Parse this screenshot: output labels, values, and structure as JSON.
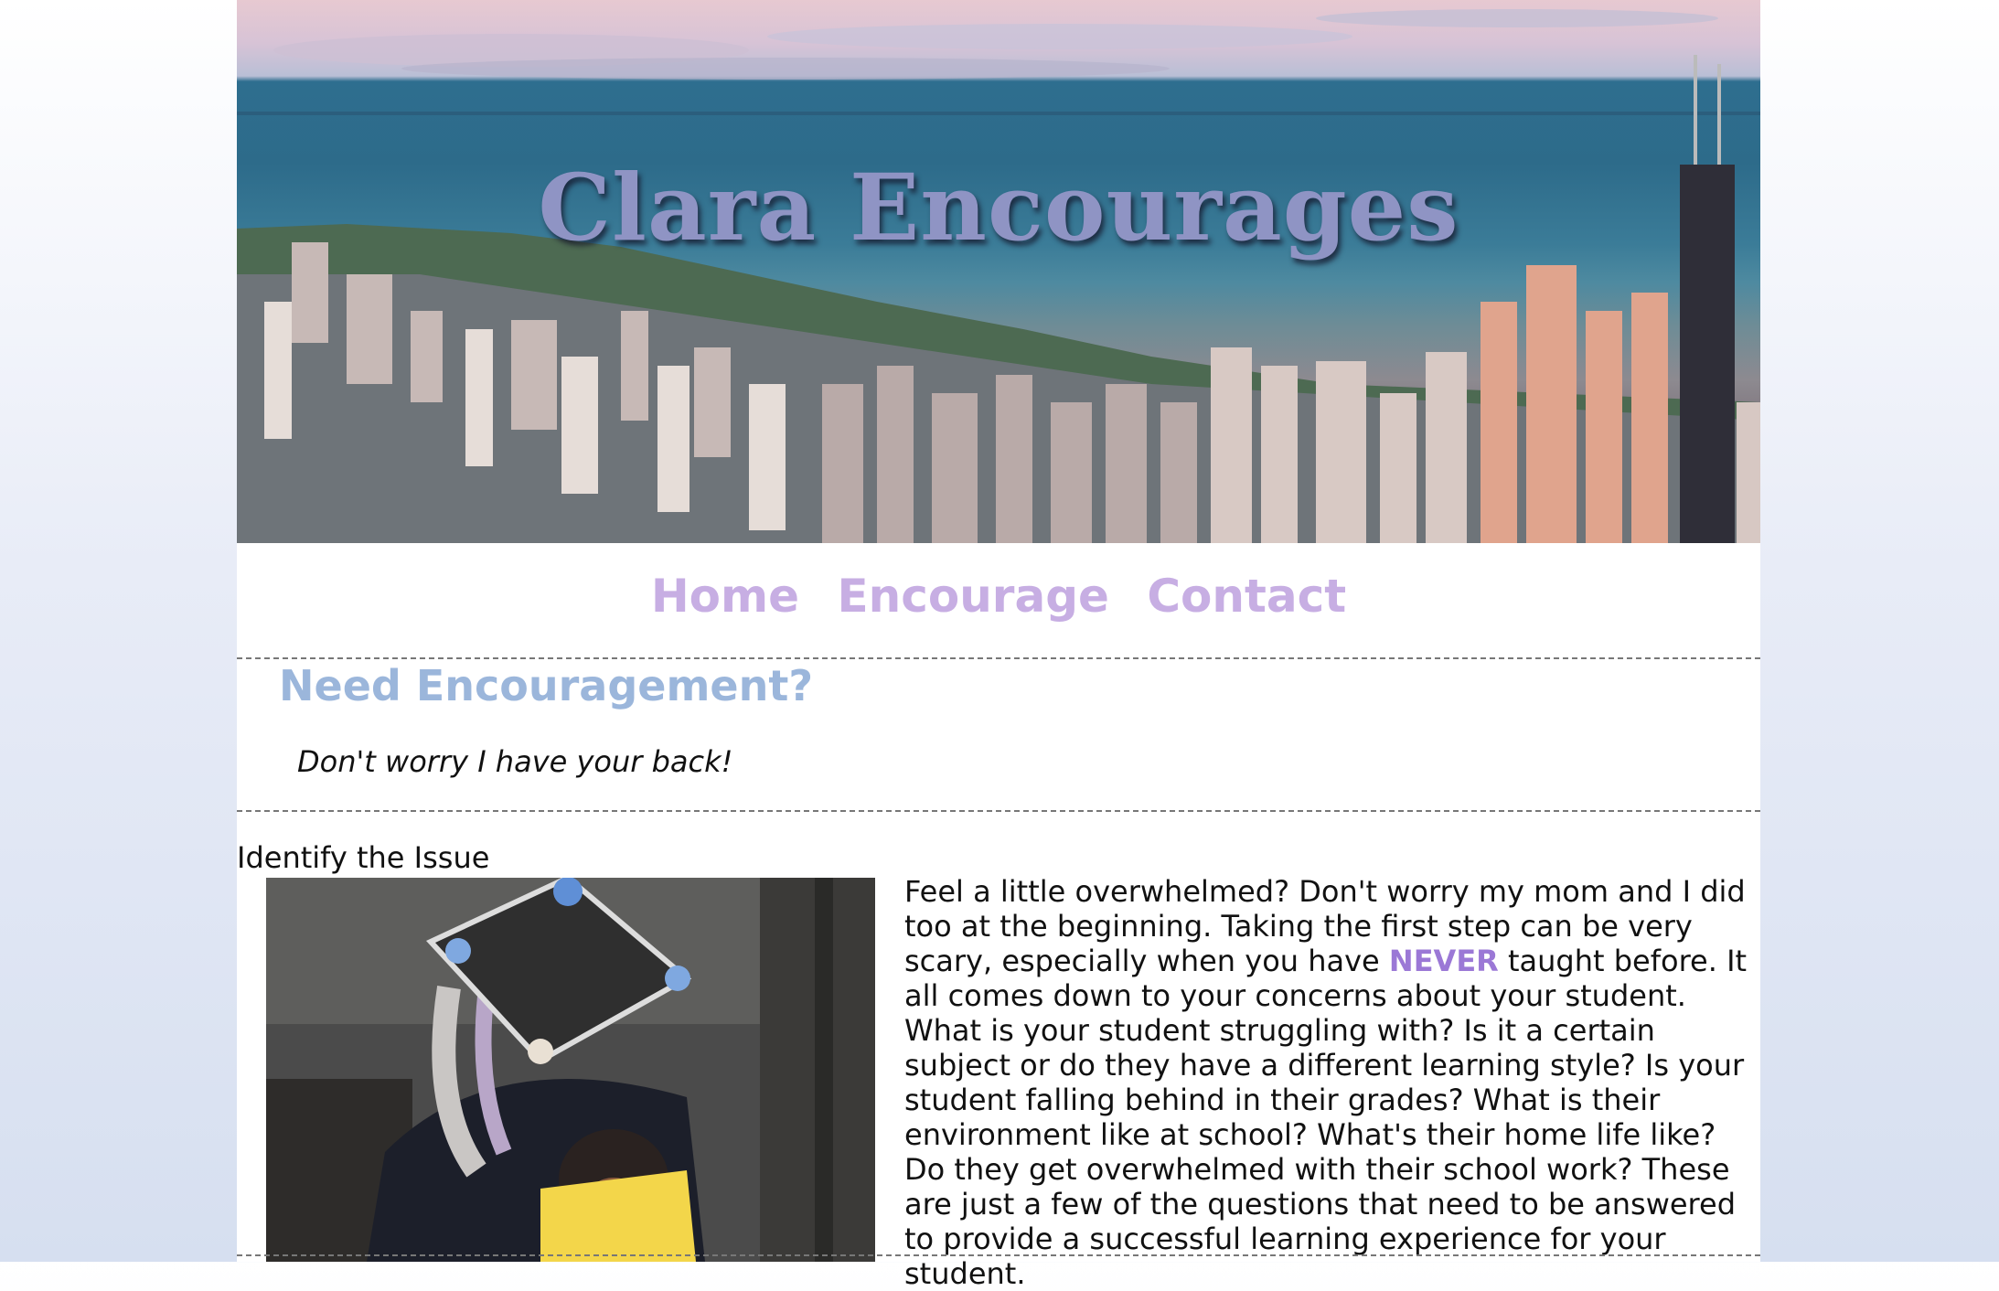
{
  "banner": {
    "title": "Clara Encourages"
  },
  "nav": {
    "items": [
      {
        "label": "Home"
      },
      {
        "label": "Encourage"
      },
      {
        "label": "Contact"
      }
    ]
  },
  "hero": {
    "heading": "Need Encouragement?",
    "subtitle": "Don't worry I have your back!"
  },
  "section": {
    "label": "Identify the Issue",
    "text_before": "Feel a little overwhelmed? Don't worry my mom and I did too at the beginning. Taking the first step can be very scary, especially when you have ",
    "emphasis": "NEVER",
    "text_after": " taught before. It all comes down to your concerns about your student. What is your student struggling with? Is it a certain subject or do they have a different learning style? Is your student falling behind in their grades? What is their environment like at school? What's their home life like? Do they get overwhelmed with their school work? These are just a few of the questions that need to be answered to provide a successful learning experience for your student."
  },
  "colors": {
    "title": "#8f94c4",
    "nav": "#c7aee3",
    "heading": "#9bb6db",
    "emphasis": "#9b78d6"
  }
}
